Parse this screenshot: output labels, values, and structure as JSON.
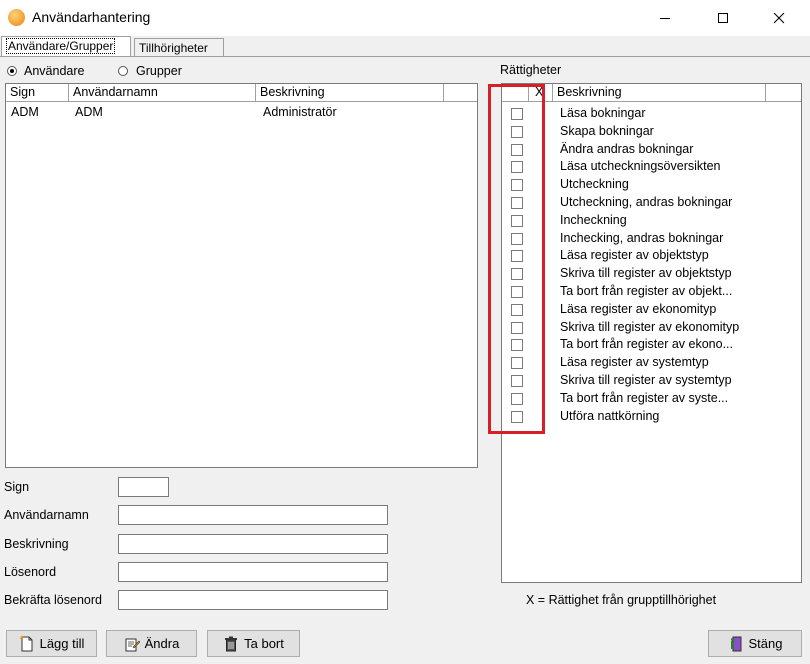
{
  "window": {
    "title": "Användarhantering"
  },
  "tabs": [
    {
      "label": "Användare/Grupper"
    },
    {
      "label": "Tillhörigheter"
    }
  ],
  "radios": {
    "users_label": "Användare",
    "groups_label": "Grupper",
    "selected": "Användare"
  },
  "users_table": {
    "columns": [
      "Sign",
      "Användarnamn",
      "Beskrivning"
    ],
    "rows": [
      {
        "sign": "ADM",
        "username": "ADM",
        "description": "Administratör"
      }
    ]
  },
  "rights": {
    "title": "Rättigheter",
    "columns": [
      "",
      "X",
      "Beskrivning"
    ],
    "items": [
      "Läsa bokningar",
      "Skapa bokningar",
      "Ändra andras bokningar",
      "Läsa utcheckningsöversikten",
      "Utcheckning",
      "Utcheckning, andras bokningar",
      "Incheckning",
      "Inchecking, andras bokningar",
      "Läsa register av objektstyp",
      "Skriva till register av objektstyp",
      "Ta bort från register av objekt...",
      "Läsa register av ekonomityp",
      "Skriva till register av ekonomityp",
      "Ta bort från register av ekono...",
      "Läsa register av systemtyp",
      "Skriva till register av systemtyp",
      "Ta bort från register av syste...",
      "Utföra nattkörning"
    ],
    "legend": "X = Rättighet från grupptillhörighet"
  },
  "form": {
    "sign_label": "Sign",
    "sign_value": "",
    "username_label": "Användarnamn",
    "username_value": "",
    "description_label": "Beskrivning",
    "description_value": "",
    "password_label": "Lösenord",
    "password_value": "",
    "confirm_label": "Bekräfta lösenord",
    "confirm_value": ""
  },
  "buttons": {
    "add": "Lägg till",
    "edit": "Ändra",
    "delete": "Ta bort",
    "close": "Stäng"
  },
  "colors": {
    "highlight_box": "#d61f26",
    "client_bg": "#f0f0f0"
  }
}
